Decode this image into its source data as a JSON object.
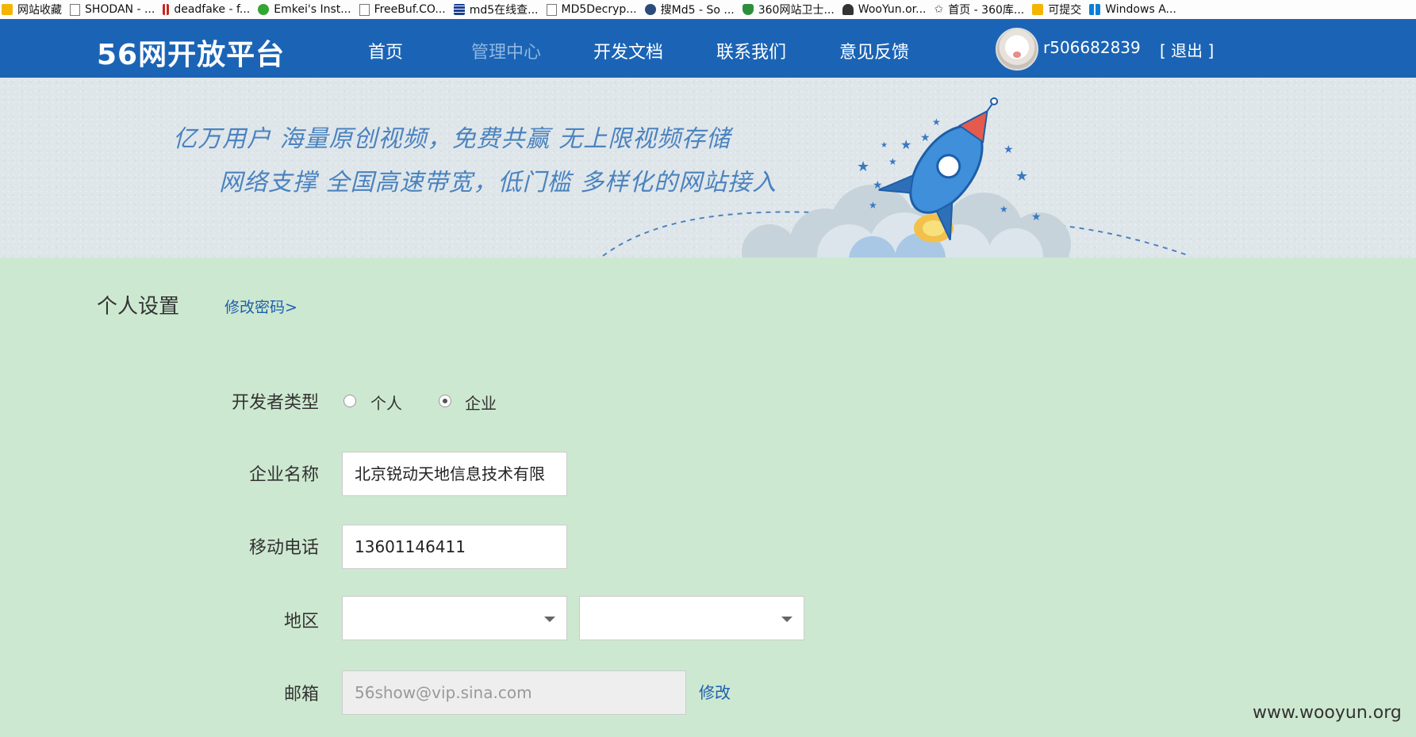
{
  "bookmarks": [
    {
      "label": "网站收藏",
      "icon": "folder-icon"
    },
    {
      "label": "SHODAN - ...",
      "icon": "page-icon"
    },
    {
      "label": "deadfake - f...",
      "icon": "bars-icon"
    },
    {
      "label": "Emkei's Inst...",
      "icon": "green-globe-icon"
    },
    {
      "label": "FreeBuf.CO...",
      "icon": "page-icon"
    },
    {
      "label": "md5在线查...",
      "icon": "grid-icon"
    },
    {
      "label": "MD5Decryp...",
      "icon": "page-icon"
    },
    {
      "label": "搜Md5 - So ...",
      "icon": "wooyun-icon"
    },
    {
      "label": "360网站卫士...",
      "icon": "shield-icon"
    },
    {
      "label": "WooYun.or...",
      "icon": "cloud-icon"
    },
    {
      "label": "首页 - 360库...",
      "icon": "star-icon"
    },
    {
      "label": "可提交",
      "icon": "folder-icon"
    },
    {
      "label": "Windows A...",
      "icon": "windows-icon"
    }
  ],
  "header": {
    "logo": "56网开放平台",
    "nav": [
      {
        "label": "首页",
        "active": false
      },
      {
        "label": "管理中心",
        "active": true
      },
      {
        "label": "开发文档",
        "active": false
      },
      {
        "label": "联系我们",
        "active": false
      },
      {
        "label": "意见反馈",
        "active": false
      }
    ],
    "username": "r506682839",
    "logout": "[ 退出 ]"
  },
  "banner": {
    "line1": "亿万用户 海量原创视频，免费共赢 无上限视频存储",
    "line2": "网络支撑 全国高速带宽，低门槛 多样化的网站接入"
  },
  "page": {
    "title": "个人设置",
    "change_password": "修改密码>"
  },
  "form": {
    "developer_type_label": "开发者类型",
    "developer_type_options": [
      {
        "label": "个人",
        "checked": false
      },
      {
        "label": "企业",
        "checked": true
      }
    ],
    "company_label": "企业名称",
    "company_value": "北京锐动天地信息技术有限",
    "phone_label": "移动电话",
    "phone_value": "13601146411",
    "region_label": "地区",
    "province_value": "",
    "city_value": "",
    "email_label": "邮箱",
    "email_value": "56show@vip.sina.com",
    "email_modify": "修改"
  },
  "watermark": "www.wooyun.org",
  "colors": {
    "header_bg": "#1b64b5",
    "page_bg": "#cde8d0",
    "link": "#1c5fae",
    "slogan": "#4b83bf"
  }
}
